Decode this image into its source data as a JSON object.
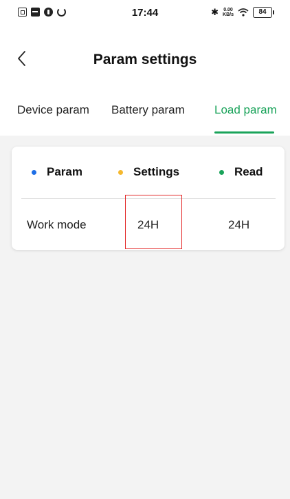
{
  "status_bar": {
    "time": "17:44",
    "net_speed_value": "0.00",
    "net_speed_unit": "KB/s",
    "battery": "84",
    "icons": [
      "sim-icon",
      "message-icon",
      "app-icon",
      "sync-icon",
      "bluetooth-icon",
      "wifi-icon",
      "battery-icon"
    ]
  },
  "header": {
    "back_icon": "chevron-left-icon",
    "title": "Param settings"
  },
  "tabs": [
    {
      "label": "Device param",
      "active": false
    },
    {
      "label": "Battery param",
      "active": false
    },
    {
      "label": "Load param",
      "active": true
    }
  ],
  "table": {
    "columns": [
      {
        "label": "Param",
        "dot_color": "#1e6ee6"
      },
      {
        "label": "Settings",
        "dot_color": "#f5b82e"
      },
      {
        "label": "Read",
        "dot_color": "#1aa35a"
      }
    ],
    "rows": [
      {
        "param": "Work mode",
        "settings": "24H",
        "read": "24H"
      }
    ]
  },
  "colors": {
    "accent": "#1aa35a",
    "background": "#f3f3f3",
    "highlight": "#e32727"
  }
}
